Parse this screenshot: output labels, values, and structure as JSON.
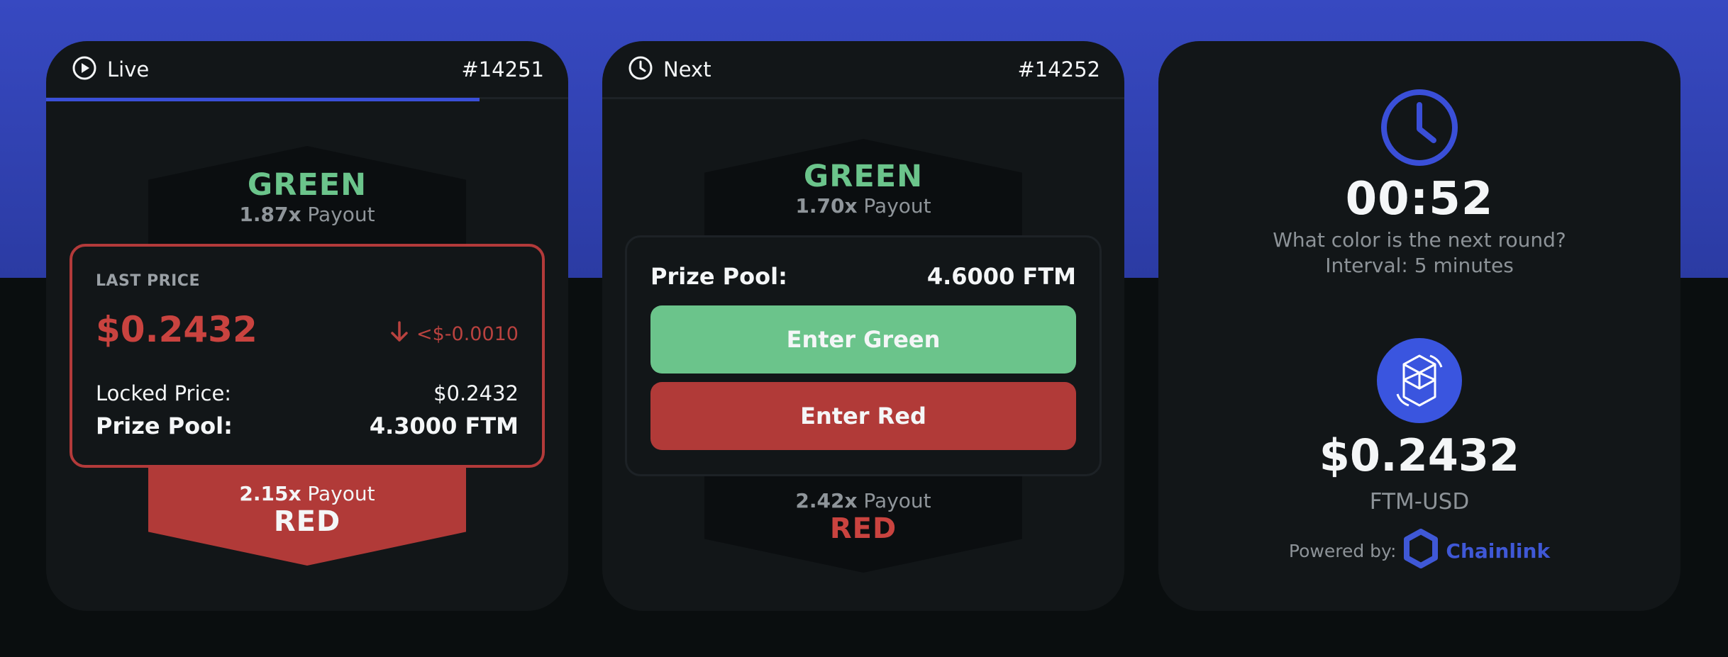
{
  "live_card": {
    "status": "Live",
    "round_id": "#14251",
    "progress": 0.83,
    "green": {
      "label": "GREEN",
      "multiplier": "1.87x",
      "payout_label": "Payout"
    },
    "red": {
      "label": "RED",
      "multiplier": "2.15x",
      "payout_label": "Payout"
    },
    "last_price_label": "LAST PRICE",
    "last_price": "$0.2432",
    "price_change": "<$-0.0010",
    "locked_price_label": "Locked Price:",
    "locked_price": "$0.2432",
    "prize_pool_label": "Prize Pool:",
    "prize_pool": "4.3000 FTM"
  },
  "next_card": {
    "status": "Next",
    "round_id": "#14252",
    "green": {
      "label": "GREEN",
      "multiplier": "1.70x",
      "payout_label": "Payout"
    },
    "red": {
      "label": "RED",
      "multiplier": "2.42x",
      "payout_label": "Payout"
    },
    "prize_pool_label": "Prize Pool:",
    "prize_pool": "4.6000 FTM",
    "enter_green": "Enter Green",
    "enter_red": "Enter Red"
  },
  "info_card": {
    "timer": "00:52",
    "question": "What color is the next round?",
    "interval": "Interval: 5 minutes",
    "price": "$0.2432",
    "pair": "FTM-USD",
    "powered_by": "Powered by:",
    "provider": "Chainlink"
  },
  "colors": {
    "accent": "#3a4fd8",
    "green": "#6bc48b",
    "red": "#b13a38",
    "card": "#121618"
  },
  "icons": [
    "play-circle-icon",
    "clock-icon",
    "arrow-down-icon",
    "fantom-icon",
    "chainlink-icon"
  ]
}
